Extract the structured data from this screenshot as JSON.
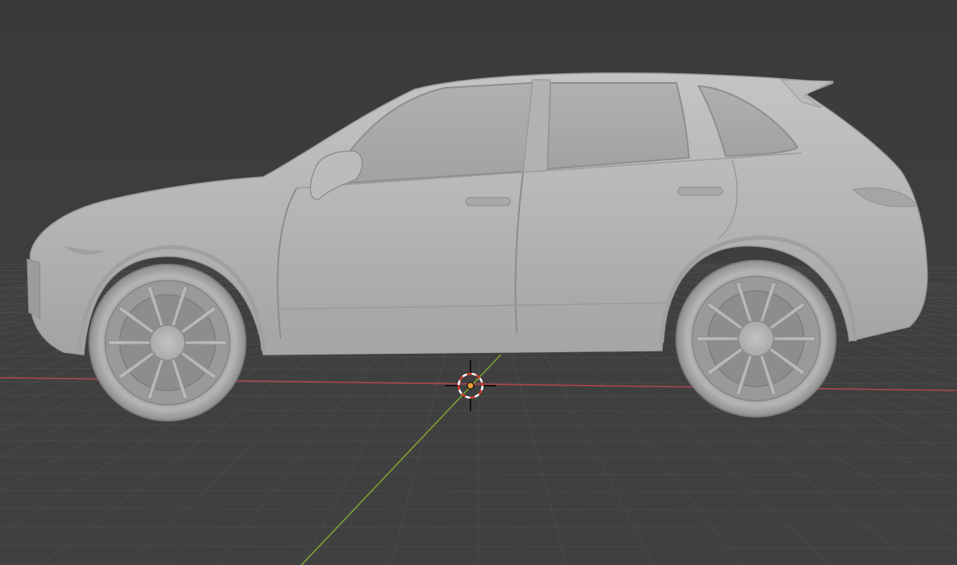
{
  "viewport": {
    "mode": "solid-shading",
    "background_color": "#3d3d3d",
    "grid_line_color": "#4a4a4a",
    "x_axis_color": "#b04650",
    "y_axis_color": "#7da132"
  },
  "scene": {
    "object": "car-model",
    "body_color": "#b4b4b4",
    "window_color": "#a6a6a6",
    "tire_color": "#8c8c8c",
    "rim_color": "#b8b8b8",
    "cursor_colors": {
      "ring_outer": "#ffffff",
      "ring_inner": "#d43a2a",
      "origin_dot": "#f0a030",
      "crosshair": "#000000"
    }
  }
}
